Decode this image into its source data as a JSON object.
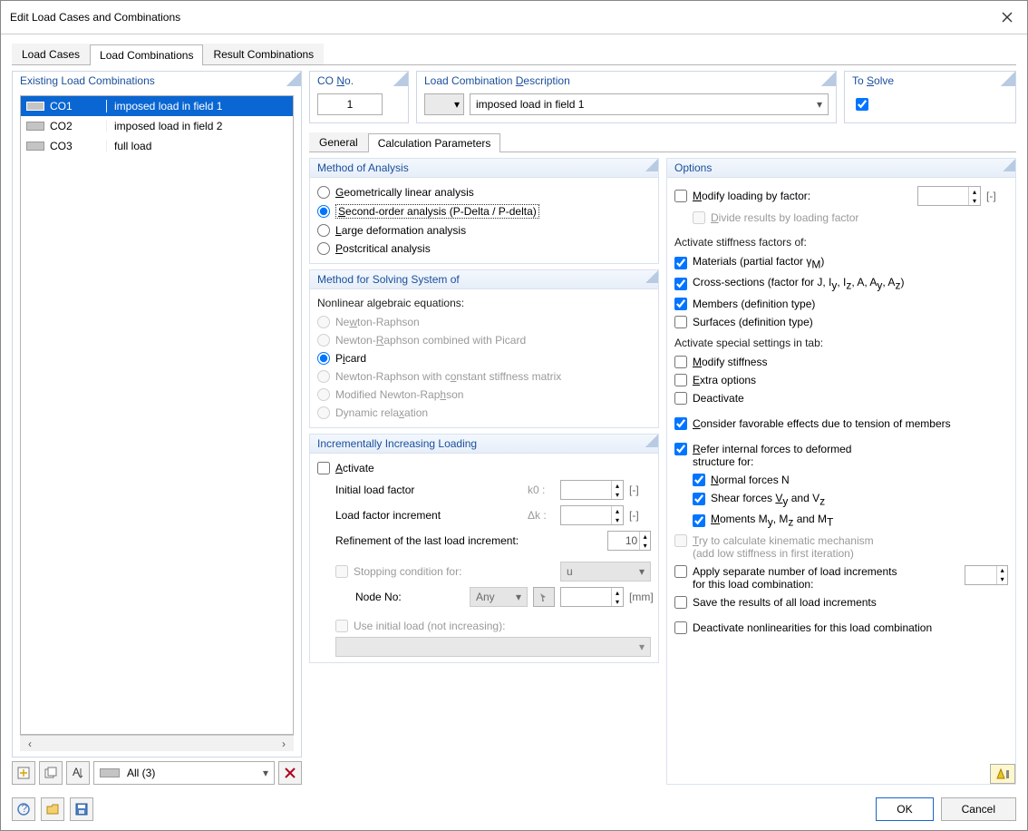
{
  "window": {
    "title": "Edit Load Cases and Combinations"
  },
  "mainTabs": {
    "t0": "Load Cases",
    "t1": "Load Combinations",
    "t2": "Result Combinations",
    "activeIndex": 1
  },
  "leftPanel": {
    "title": "Existing Load Combinations",
    "rows": [
      {
        "id": "CO1",
        "desc": "imposed load in field 1",
        "selected": true
      },
      {
        "id": "CO2",
        "desc": "imposed load in field 2",
        "selected": false
      },
      {
        "id": "CO3",
        "desc": "full load",
        "selected": false
      }
    ],
    "filterLabel": "All (3)"
  },
  "coNo": {
    "title": "CO No.",
    "value": "1"
  },
  "desc": {
    "title": "Load Combination Description",
    "value": "imposed load in field 1"
  },
  "solve": {
    "title": "To Solve",
    "checked": true
  },
  "subTabs": {
    "t0": "General",
    "t1": "Calculation Parameters",
    "activeIndex": 1
  },
  "method": {
    "title": "Method of Analysis",
    "opt0": "Geometrically linear analysis",
    "opt1": "Second-order analysis (P-Delta / P-delta)",
    "opt2": "Large deformation analysis",
    "opt3": "Postcritical analysis",
    "selected": 1
  },
  "solver": {
    "title": "Method for Solving System of",
    "subtitle": "Nonlinear algebraic equations:",
    "opt0": "Newton-Raphson",
    "opt1": "Newton-Raphson combined with Picard",
    "opt2": "Picard",
    "opt3": "Newton-Raphson with constant stiffness matrix",
    "opt4": "Modified Newton-Raphson",
    "opt5": "Dynamic relaxation",
    "selected": 2
  },
  "incr": {
    "title": "Incrementally Increasing Loading",
    "activate": "Activate",
    "initial": "Initial load factor",
    "initialSym": "k0 :",
    "increment": "Load factor increment",
    "incrementSym": "Δk :",
    "refine": "Refinement of the last load increment:",
    "refineVal": "10",
    "stopCond": "Stopping condition for:",
    "stopSel": "u",
    "nodeNo": "Node No:",
    "nodeSel": "Any",
    "nodeUnit": "[mm]",
    "useInitial": "Use initial load (not increasing):",
    "unit": "[-]"
  },
  "options": {
    "title": "Options",
    "modifyFactor": "Modify loading by factor:",
    "modifyUnit": "[-]",
    "divideResults": "Divide results by loading factor",
    "stiffTitle": "Activate stiffness factors of:",
    "materials": "Materials (partial factor γM)",
    "cross": "Cross-sections (factor for J, Iy, Iz, A, Ay, Az)",
    "members": "Members (definition type)",
    "surfaces": "Surfaces (definition type)",
    "specialTitle": "Activate special settings in tab:",
    "modifyStiff": "Modify stiffness",
    "extra": "Extra options",
    "deactivate": "Deactivate",
    "favorable": "Consider favorable effects due to tension of members",
    "referLine1": "Refer internal forces to deformed",
    "referLine2": "structure for:",
    "normal": "Normal forces N",
    "shear": "Shear forces Vy and Vz",
    "moments": "Moments My, Mz and MT",
    "kinematic1": "Try to calculate kinematic mechanism",
    "kinematic2": "(add low stiffness in first iteration)",
    "separateIncr1": "Apply separate number of load increments",
    "separateIncr2": "for this load combination:",
    "saveResults": "Save the results of all load increments",
    "deactNonlin": "Deactivate nonlinearities for this load combination"
  },
  "footer": {
    "ok": "OK",
    "cancel": "Cancel"
  }
}
